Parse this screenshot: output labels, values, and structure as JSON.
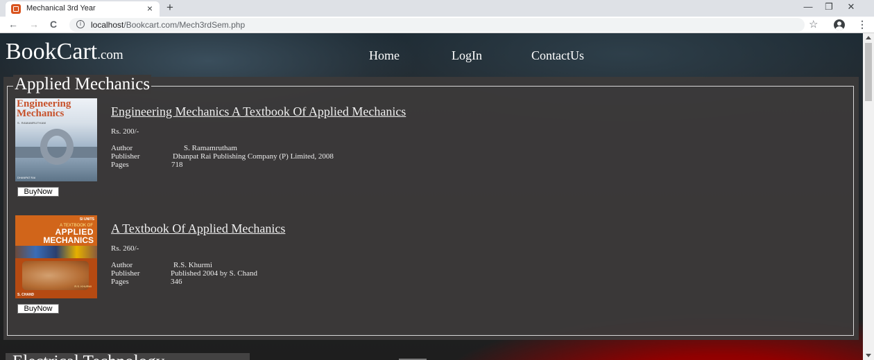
{
  "browser": {
    "tab_title": "Mechanical 3rd Year",
    "tab_close": "×",
    "new_tab": "+",
    "url_host": "localhost",
    "url_path": "/Bookcart.com/Mech3rdSem.php",
    "nav_back": "←",
    "nav_forward": "→",
    "nav_reload": "C",
    "info": "i",
    "star": "☆",
    "menu": "⋮",
    "win_minimize": "—",
    "win_restore": "❐",
    "win_close": "✕"
  },
  "site": {
    "logo_main": "BookCart",
    "logo_suffix": ".com",
    "nav": {
      "home": "Home",
      "login": "LogIn",
      "contact": "ContactUs"
    }
  },
  "section": {
    "title": "Applied Mechanics",
    "labels": {
      "author": "Author",
      "publisher": "Publisher",
      "pages": "Pages"
    },
    "buy_label": "BuyNow",
    "books": [
      {
        "title": "Engineering Mechanics A Textbook Of Applied Mechanics",
        "price": "Rs. 200/-",
        "author": "S. Ramamrutham",
        "publisher": "Dhanpat Rai Publishing Company (P) Limited, 2008",
        "pages": "718",
        "cover": {
          "title_line1": "Engineering",
          "title_line2": "Mechanics",
          "author": "S. RAMAMRUTHAM",
          "publisher": "DHANPAT RAI"
        }
      },
      {
        "title": "A Textbook Of Applied Mechanics",
        "price": "Rs. 260/-",
        "author": "R.S. Khurmi",
        "publisher": "Published 2004 by S. Chand",
        "pages": "346",
        "cover": {
          "units": "SI UNITS",
          "subtitle": "A TEXTBOOK OF",
          "line1": "APPLIED",
          "line2": "MECHANICS",
          "author": "R.S. KHURMI",
          "publisher": "S. CHAND"
        }
      }
    ]
  },
  "next_section": {
    "title": "Electrical Technology"
  },
  "colors": {
    "background": "#202020",
    "panel": "#3c3a3a",
    "accent_red": "#b00000",
    "text": "#ffffff"
  }
}
